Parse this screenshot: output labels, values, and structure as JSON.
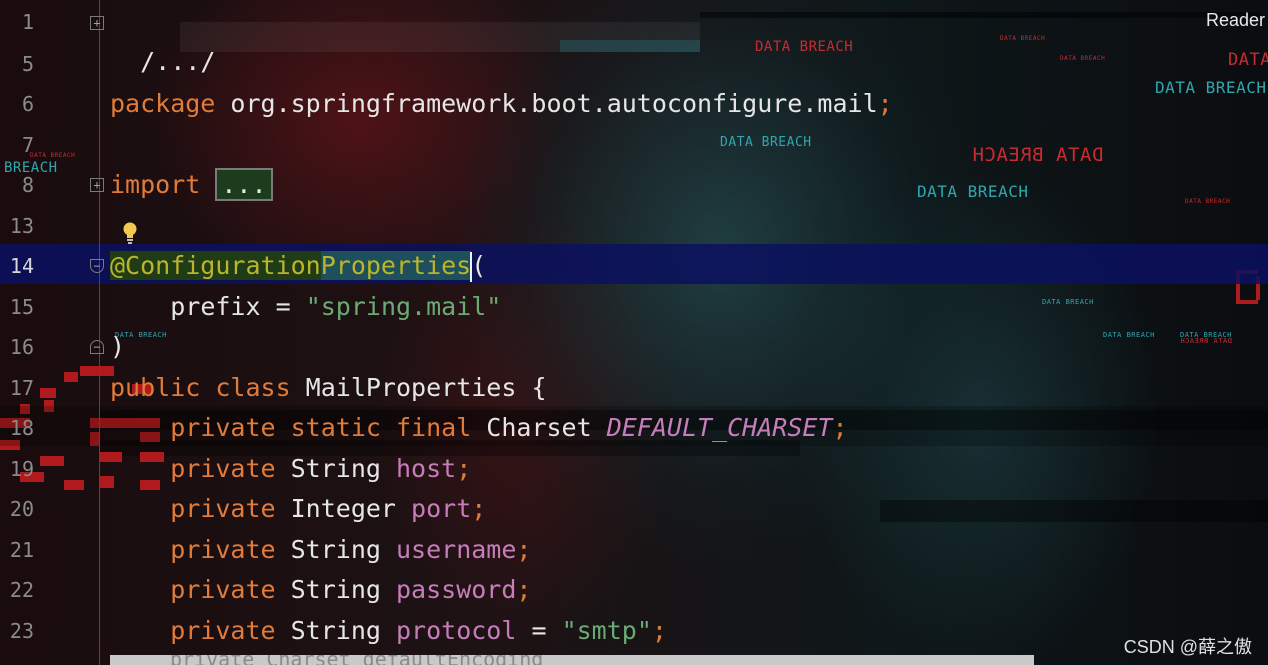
{
  "editor": {
    "reader_label": "Reader",
    "watermark": "CSDN @薛之傲",
    "popup_text": "private Charset defaultEncoding",
    "lines": [
      {
        "no": "1"
      },
      {
        "no": "5"
      },
      {
        "no": "6"
      },
      {
        "no": "7"
      },
      {
        "no": "8"
      },
      {
        "no": "13"
      },
      {
        "no": "14"
      },
      {
        "no": "15"
      },
      {
        "no": "16"
      },
      {
        "no": "17"
      },
      {
        "no": "18"
      },
      {
        "no": "19"
      },
      {
        "no": "20"
      },
      {
        "no": "21"
      },
      {
        "no": "22"
      },
      {
        "no": "23"
      }
    ],
    "code": {
      "l1": "/.../",
      "l6_kw": "package",
      "l6_rest": " org.springframework.boot.autoconfigure.mail",
      "l6_semi": ";",
      "l8_kw": "import",
      "l8_collapsed": "...",
      "l14_at": "@Configuration",
      "l14_prop": "Properties",
      "l14_paren": "(",
      "l15_key": "prefix = ",
      "l15_val": "\"spring.mail\"",
      "l16": ")",
      "l17_kw": "public class",
      "l17_rest": " MailProperties {",
      "l18_kw": "private static final",
      "l18_type": " Charset ",
      "l18_field": "DEFAULT_CHARSET",
      "l18_semi": ";",
      "l19_kw": "private",
      "l19_type": " String ",
      "l19_field": "host",
      "l19_semi": ";",
      "l20_kw": "private",
      "l20_type": " Integer ",
      "l20_field": "port",
      "l20_semi": ";",
      "l21_kw": "private",
      "l21_type": " String ",
      "l21_field": "username",
      "l21_semi": ";",
      "l22_kw": "private",
      "l22_type": " String ",
      "l22_field": "password",
      "l22_semi": ";",
      "l23_kw": "private",
      "l23_type": " String ",
      "l23_field": "protocol",
      "l23_eq": " = ",
      "l23_val": "\"smtp\"",
      "l23_semi": ";"
    }
  },
  "background_text": {
    "breach": "DATA BREACH",
    "breach_cut": "BREACH",
    "breach_cut2": "DATA"
  },
  "colors": {
    "keyword": "#e07b39",
    "annotation": "#bbb529",
    "string": "#6aab73",
    "field": "#c77dbb",
    "caret_line": "#0a105f"
  }
}
